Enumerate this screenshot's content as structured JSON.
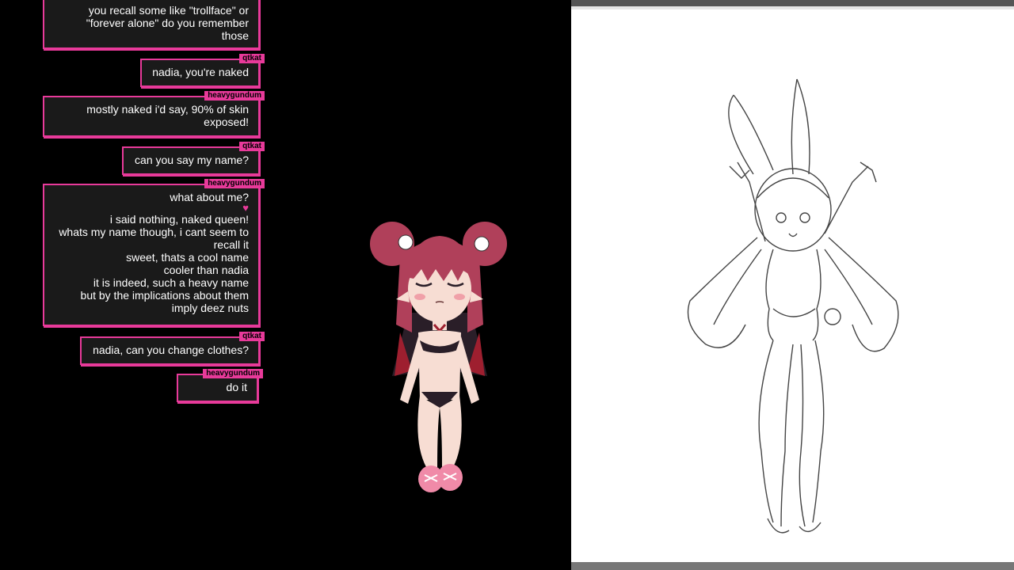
{
  "chat": {
    "messages": [
      {
        "lines": [
          "you recall some like \"trollface\" or",
          "\"forever alone\" do you remember",
          "those"
        ]
      },
      {
        "user": "qtkat",
        "lines": [
          "nadia, you're naked"
        ]
      },
      {
        "user": "heavygundum",
        "lines": [
          "mostly naked i'd say, 90% of skin",
          "exposed!"
        ]
      },
      {
        "user": "qtkat",
        "lines": [
          "can you say my name?"
        ]
      },
      {
        "user": "heavygundum",
        "first": "what about me?",
        "heart": "♥",
        "lines": [
          "i said nothing, naked queen!",
          "whats my name though, i cant seem to",
          "recall it",
          "sweet, thats a cool name",
          "cooler than nadia",
          "it is indeed, such a heavy name",
          "but by the implications about them",
          "imply deez nuts"
        ]
      },
      {
        "user": "qtkat",
        "lines": [
          "nadia, can you change clothes?"
        ]
      },
      {
        "user": "heavygundum",
        "lines": [
          "do it"
        ]
      }
    ]
  },
  "colors": {
    "accent": "#e83a9a",
    "bubble": "#1a1a1a",
    "hair": "#b0405a",
    "skin": "#f7ddd3"
  }
}
